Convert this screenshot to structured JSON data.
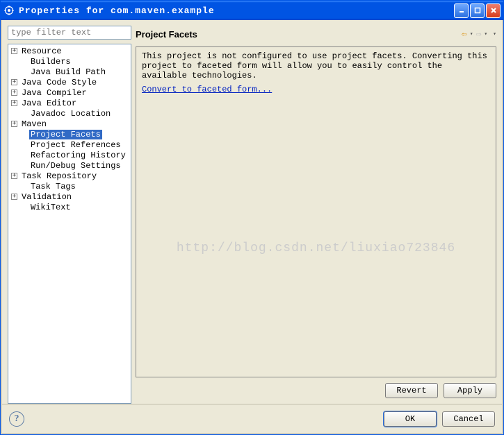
{
  "window": {
    "title": "Properties for com.maven.example"
  },
  "filter": {
    "placeholder": "type filter text"
  },
  "tree": [
    {
      "label": "Resource",
      "expandable": true,
      "depth": 0
    },
    {
      "label": "Builders",
      "expandable": false,
      "depth": 1
    },
    {
      "label": "Java Build Path",
      "expandable": false,
      "depth": 1
    },
    {
      "label": "Java Code Style",
      "expandable": true,
      "depth": 0
    },
    {
      "label": "Java Compiler",
      "expandable": true,
      "depth": 0
    },
    {
      "label": "Java Editor",
      "expandable": true,
      "depth": 0
    },
    {
      "label": "Javadoc Location",
      "expandable": false,
      "depth": 1
    },
    {
      "label": "Maven",
      "expandable": true,
      "depth": 0
    },
    {
      "label": "Project Facets",
      "expandable": false,
      "depth": 1,
      "selected": true
    },
    {
      "label": "Project References",
      "expandable": false,
      "depth": 1
    },
    {
      "label": "Refactoring History",
      "expandable": false,
      "depth": 1
    },
    {
      "label": "Run/Debug Settings",
      "expandable": false,
      "depth": 1
    },
    {
      "label": "Task Repository",
      "expandable": true,
      "depth": 0
    },
    {
      "label": "Task Tags",
      "expandable": false,
      "depth": 1
    },
    {
      "label": "Validation",
      "expandable": true,
      "depth": 0
    },
    {
      "label": "WikiText",
      "expandable": false,
      "depth": 1
    }
  ],
  "page": {
    "title": "Project Facets",
    "description": "This project is not configured to use project facets. Converting this project to faceted form will allow you to easily control the available technologies.",
    "link": "Convert to faceted form..."
  },
  "watermark": "http://blog.csdn.net/liuxiao723846",
  "buttons": {
    "revert": "Revert",
    "apply": "Apply",
    "ok": "OK",
    "cancel": "Cancel"
  }
}
